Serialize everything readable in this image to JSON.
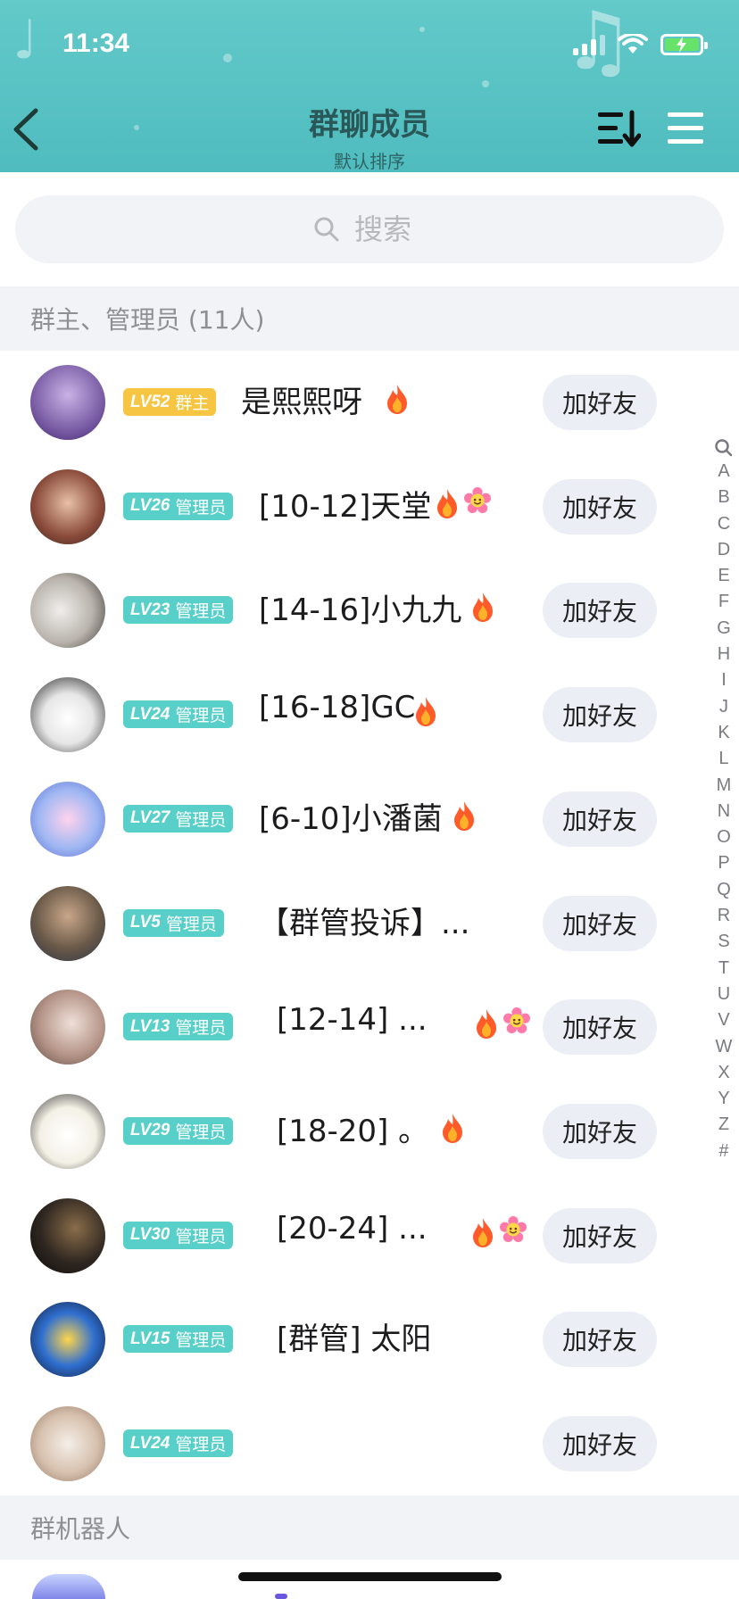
{
  "status_bar": {
    "time": "11:34"
  },
  "header": {
    "title": "群聊成员",
    "subtitle": "默认排序"
  },
  "search": {
    "placeholder": "搜索"
  },
  "sections": {
    "admins_title": "群主、管理员 (11人)",
    "bots_title": "群机器人"
  },
  "add_friend_label": "加好友",
  "members": [
    {
      "level": "LV52",
      "role": "群主",
      "name": "是熙熙呀",
      "emojis": [
        "fire"
      ]
    },
    {
      "level": "LV26",
      "role": "管理员",
      "name": "[10-12]天堂",
      "emojis": [
        "fire",
        "flower"
      ]
    },
    {
      "level": "LV23",
      "role": "管理员",
      "name": "[14-16]小九九",
      "emojis": [
        "fire"
      ]
    },
    {
      "level": "LV24",
      "role": "管理员",
      "name": "[16-18]GC",
      "emojis": [
        "fire"
      ]
    },
    {
      "level": "LV27",
      "role": "管理员",
      "name": "[6-10]小潘菌",
      "emojis": [
        "fire"
      ]
    },
    {
      "level": "LV5",
      "role": "管理员",
      "name": "【群管投诉】...",
      "emojis": []
    },
    {
      "level": "LV13",
      "role": "管理员",
      "name": "[12-14]  ...",
      "emojis": [
        "fire",
        "flower"
      ]
    },
    {
      "level": "LV29",
      "role": "管理员",
      "name": "[18-20]  。",
      "emojis": [
        "fire"
      ]
    },
    {
      "level": "LV30",
      "role": "管理员",
      "name": "[20-24]  ...",
      "emojis": [
        "fire",
        "flower"
      ]
    },
    {
      "level": "LV15",
      "role": "管理员",
      "name": "[群管]  太阳",
      "emojis": []
    },
    {
      "level": "LV24",
      "role": "管理员",
      "name": "",
      "emojis": []
    }
  ],
  "alpha_index": [
    "A",
    "B",
    "C",
    "D",
    "E",
    "F",
    "G",
    "H",
    "I",
    "J",
    "K",
    "L",
    "M",
    "N",
    "O",
    "P",
    "Q",
    "R",
    "S",
    "T",
    "U",
    "V",
    "W",
    "X",
    "Y",
    "Z",
    "#"
  ],
  "colors": {
    "header_bg": "#5cc4c5",
    "owner_badge": "#f6c541",
    "admin_badge": "#58cfc8",
    "button_bg": "#eceef5"
  }
}
